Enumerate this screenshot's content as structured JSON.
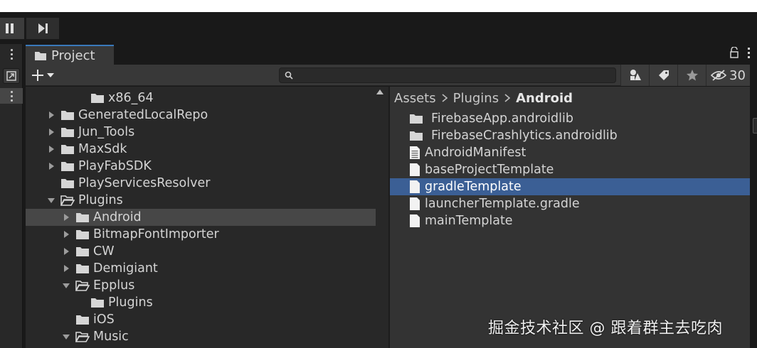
{
  "window": {
    "tab_title": "Project",
    "hidden_count": "30"
  },
  "search": {
    "placeholder": "",
    "value": ""
  },
  "tree": [
    {
      "label": "x86_64",
      "depth": 3,
      "arrow": "none",
      "open": false,
      "selected": false
    },
    {
      "label": "GeneratedLocalRepo",
      "depth": 1,
      "arrow": "collapsed",
      "open": false,
      "selected": false
    },
    {
      "label": "Jun_Tools",
      "depth": 1,
      "arrow": "collapsed",
      "open": false,
      "selected": false
    },
    {
      "label": "MaxSdk",
      "depth": 1,
      "arrow": "collapsed",
      "open": false,
      "selected": false
    },
    {
      "label": "PlayFabSDK",
      "depth": 1,
      "arrow": "collapsed",
      "open": false,
      "selected": false
    },
    {
      "label": "PlayServicesResolver",
      "depth": 1,
      "arrow": "none",
      "open": false,
      "selected": false
    },
    {
      "label": "Plugins",
      "depth": 1,
      "arrow": "expanded",
      "open": true,
      "selected": false
    },
    {
      "label": "Android",
      "depth": 2,
      "arrow": "collapsed",
      "open": false,
      "selected": true
    },
    {
      "label": "BitmapFontImporter",
      "depth": 2,
      "arrow": "collapsed",
      "open": false,
      "selected": false
    },
    {
      "label": "CW",
      "depth": 2,
      "arrow": "collapsed",
      "open": false,
      "selected": false
    },
    {
      "label": "Demigiant",
      "depth": 2,
      "arrow": "collapsed",
      "open": false,
      "selected": false
    },
    {
      "label": "Epplus",
      "depth": 2,
      "arrow": "expanded",
      "open": true,
      "selected": false
    },
    {
      "label": "Plugins",
      "depth": 3,
      "arrow": "none",
      "open": false,
      "selected": false
    },
    {
      "label": "iOS",
      "depth": 2,
      "arrow": "none",
      "open": false,
      "selected": false
    },
    {
      "label": "Music",
      "depth": 2,
      "arrow": "expanded",
      "open": true,
      "selected": false
    }
  ],
  "breadcrumb": [
    "Assets",
    "Plugins",
    "Android"
  ],
  "files": [
    {
      "label": "FirebaseApp.androidlib",
      "type": "folder",
      "selected": false
    },
    {
      "label": "FirebaseCrashlytics.androidlib",
      "type": "folder",
      "selected": false
    },
    {
      "label": "AndroidManifest",
      "type": "text",
      "selected": false
    },
    {
      "label": "baseProjectTemplate",
      "type": "file",
      "selected": false
    },
    {
      "label": "gradleTemplate",
      "type": "file",
      "selected": true
    },
    {
      "label": "launcherTemplate.gradle",
      "type": "file",
      "selected": false
    },
    {
      "label": "mainTemplate",
      "type": "file",
      "selected": false
    }
  ],
  "watermark": "掘金技术社区 @ 跟着群主去吃肉",
  "colors": {
    "selection_focused": "#3b5f95",
    "selection_unfocused": "#474747",
    "tab_accent": "#3a79bb"
  }
}
